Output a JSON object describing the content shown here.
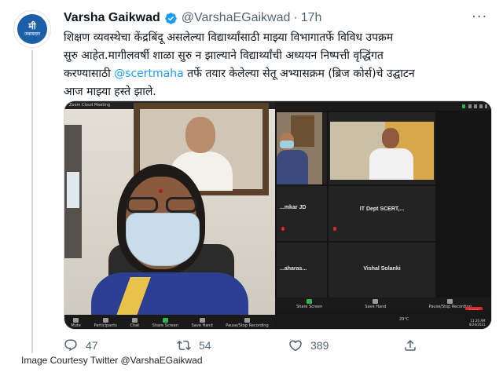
{
  "profile": {
    "avatar_top": "मी",
    "avatar_bottom": "जबाबदार",
    "name": "Varsha Gaikwad",
    "handle": "@VarshaEGaikwad",
    "separator": "·",
    "time": "17h",
    "verified": true
  },
  "more_label": "···",
  "tweet": {
    "line1": "शिक्षण व्यवस्थेचा केंद्रबिंदू असलेल्या विद्यार्थ्यांसाठी माझ्या विभागातर्फे विविध उपक्रम",
    "line2": "सुरु आहेत.मागीलवर्षी शाळा सुरु न झाल्याने विद्यार्थ्यांची अध्ययन निष्पत्ती वृद्धिंगत",
    "line3_pre": "करण्यासाठी ",
    "line3_mention": "@scertmaha",
    "line3_post": " तर्फे तयार केलेल्या सेतू अभ्यासक्रम (ब्रिज कोर्स)चे उद्घाटन",
    "line4": "आज माझ्या हस्ते झाले."
  },
  "media": {
    "left_window_title": "Zoom Cloud Meeting",
    "right_tiles": [
      {
        "name": "...mkar JD"
      },
      {
        "name": "IT Dept SCERT,..."
      },
      {
        "name": "...aharas..."
      },
      {
        "name": "Vishal Solanki"
      }
    ],
    "left_toolbar": [
      "Mute",
      "Participants",
      "Chat",
      "Share Screen",
      "Save Hand",
      "Pause/Stop Recording"
    ],
    "right_toolbar": [
      "Share Screen",
      "Save Hand",
      "Pause/Stop Recording"
    ],
    "leave_label": "Leave",
    "clock_time": "11:20 AM",
    "clock_date": "8/20/2021",
    "temperature": "29°C"
  },
  "actions": {
    "replies": "47",
    "retweets": "54",
    "likes": "389"
  },
  "credit": "Image Courtesy Twitter @VarshaEGaikwad",
  "colors": {
    "accent": "#1d9bf0",
    "text": "#0f1419",
    "muted": "#536471",
    "zoom_red": "#e02828",
    "zoom_green": "#2fb24f"
  },
  "icons": {
    "verified": "verified-badge-icon",
    "reply": "reply-icon",
    "retweet": "retweet-icon",
    "like": "heart-icon",
    "share": "share-icon"
  }
}
